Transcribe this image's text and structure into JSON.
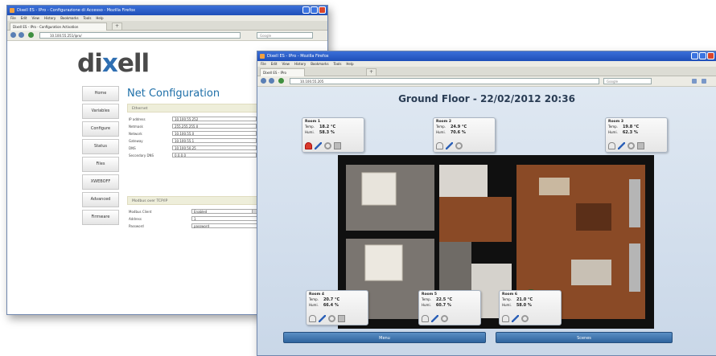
{
  "back_window": {
    "title": "Dixell ES - IPro - Configurazione di Accesso - Mozilla Firefox",
    "menu": [
      "File",
      "Edit",
      "View",
      "History",
      "Bookmarks",
      "Tools",
      "Help"
    ],
    "tab_label": "Dixell ES - IPro - Configuration Activation",
    "url": "10.100.55.251/ipro/",
    "search_placeholder": "Google",
    "logo": "dixell",
    "nav_items": [
      "Home",
      "Variables",
      "Configure",
      "Status",
      "Files",
      "XWEBOFF",
      "Advanced",
      "Firmware"
    ],
    "page_title": "Net Configuration",
    "sections": [
      "Ethernet",
      "Modbus over TCP/IP"
    ],
    "ethernet_fields": [
      {
        "label": "IP address",
        "value": "10.100.55.252"
      },
      {
        "label": "Netmask",
        "value": "255.255.255.0"
      },
      {
        "label": "Network",
        "value": "10.100.55.0"
      },
      {
        "label": "Gateway",
        "value": "10.100.55.1"
      },
      {
        "label": "DNS",
        "value": "10.100.50.25"
      },
      {
        "label": "Secondary DNS",
        "value": "0.0.0.0"
      }
    ],
    "modbus_fields": [
      {
        "label": "Modbus Client",
        "value": "Enabled"
      },
      {
        "label": "Address",
        "value": "1"
      },
      {
        "label": "Password",
        "value": "password"
      }
    ]
  },
  "front_window": {
    "title": "Dixell ES - IPro - Mozilla Firefox",
    "menu": [
      "File",
      "Edit",
      "View",
      "History",
      "Bookmarks",
      "Tools",
      "Help"
    ],
    "tab_label": "Dixell ES - IPro",
    "url": "10.100.55.205",
    "search_placeholder": "Google",
    "heading": "Ground Floor - 22/02/2012 20:36",
    "rooms": [
      {
        "name": "Room 1",
        "temp_label": "Temp.",
        "temp": "18.2 °C",
        "humi_label": "Humi.",
        "humi": "58.3 %"
      },
      {
        "name": "Room 2",
        "temp_label": "Temp.",
        "temp": "24.9 °C",
        "humi_label": "Humi.",
        "humi": "70.6 %"
      },
      {
        "name": "Room 3",
        "temp_label": "Temp.",
        "temp": "19.8 °C",
        "humi_label": "Humi.",
        "humi": "62.3 %"
      },
      {
        "name": "Room 4",
        "temp_label": "Temp.",
        "temp": "20.7 °C",
        "humi_label": "Humi.",
        "humi": "66.4 %"
      },
      {
        "name": "Room 5",
        "temp_label": "Temp.",
        "temp": "22.5 °C",
        "humi_label": "Humi.",
        "humi": "60.7 %"
      },
      {
        "name": "Room 6",
        "temp_label": "Temp.",
        "temp": "21.0 °C",
        "humi_label": "Humi.",
        "humi": "58.0 %"
      }
    ],
    "buttons": [
      "Menu",
      "Scenes"
    ],
    "colors": {
      "floor_wood": "#8a4a26",
      "floor_grey": "#76726c",
      "title_bar": "#1f4fb8"
    }
  }
}
